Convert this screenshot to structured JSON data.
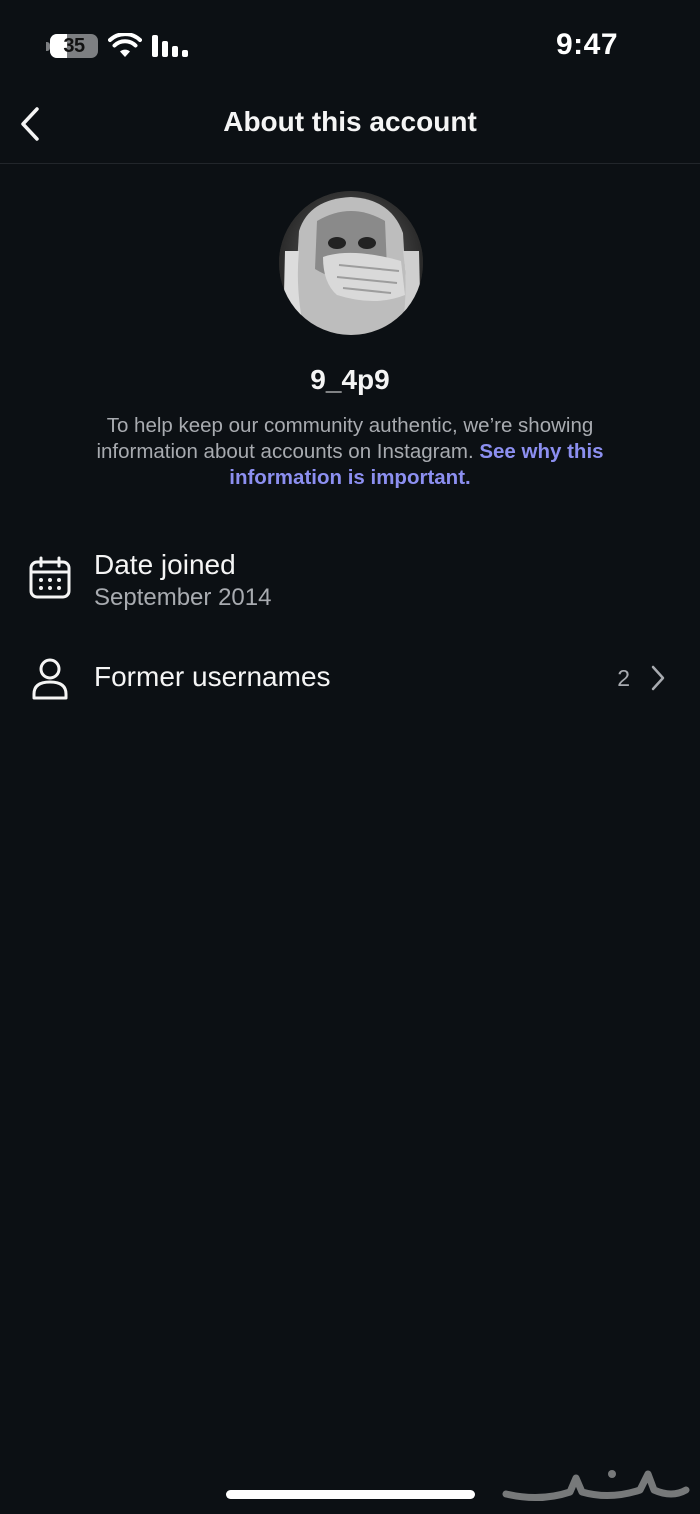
{
  "status_bar": {
    "battery_level": "35",
    "battery_percent": 35,
    "time": "9:47",
    "icons": [
      "wifi-icon",
      "signal-icon"
    ]
  },
  "header": {
    "title": "About this account",
    "back_icon": "chevron-left-icon"
  },
  "profile": {
    "username": "9_4p9",
    "description": "To help keep our community authentic, we’re showing information about accounts on Instagram.",
    "link_text": "See why this information is important."
  },
  "details": {
    "date_joined": {
      "icon": "calendar-icon",
      "label": "Date joined",
      "value": "September 2014"
    },
    "former_usernames": {
      "icon": "person-icon",
      "label": "Former usernames",
      "count": "2",
      "chevron_icon": "chevron-right-icon"
    }
  },
  "colors": {
    "background": "#0c1014",
    "text_primary": "#f5f5f5",
    "text_secondary": "#a8abb0",
    "link": "#8c8ff0"
  }
}
